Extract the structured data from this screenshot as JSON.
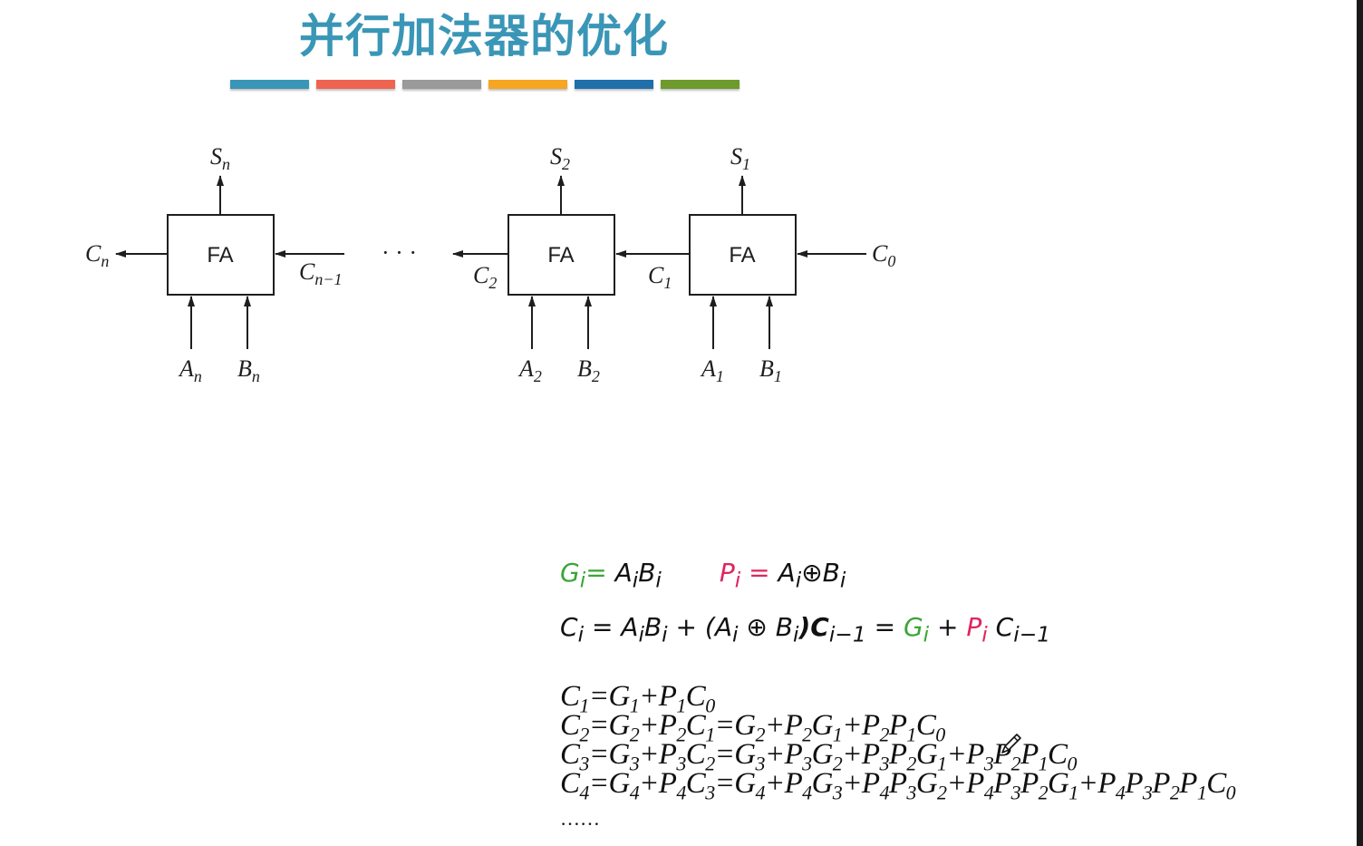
{
  "slide": {
    "title": "并行加法器的优化",
    "accent_colors": [
      "#3a96b6",
      "#ef6351",
      "#9a9a9a",
      "#f6a623",
      "#1f6faa",
      "#6e9a2e"
    ],
    "green": "#3aa535",
    "pink": "#e0245e"
  },
  "diagram": {
    "cell_label": "FA",
    "ellipsis": "· · ·",
    "labels": {
      "Sn": "S",
      "Sn_sub": "n",
      "S2": "S",
      "S2_sub": "2",
      "S1": "S",
      "S1_sub": "1",
      "Cn": "C",
      "Cn_sub": "n",
      "Cn1": "C",
      "Cn1_sub": "n−1",
      "C2": "C",
      "C2_sub": "2",
      "C1": "C",
      "C1_sub": "1",
      "C0": "C",
      "C0_sub": "0",
      "An": "A",
      "An_sub": "n",
      "Bn": "B",
      "Bn_sub": "n",
      "A2": "A",
      "A2_sub": "2",
      "B2": "B",
      "B2_sub": "2",
      "A1": "A",
      "A1_sub": "1",
      "B1": "B",
      "B1_sub": "1"
    }
  },
  "formulas": {
    "g_lhs": "G",
    "g_lhs_sub": "i",
    "g_eq": "= ",
    "g_rhs_a": "A",
    "g_rhs_a_sub": "i",
    "g_rhs_b": "B",
    "g_rhs_b_sub": "i",
    "p_lhs": "P",
    "p_lhs_sub": "i",
    "p_eq": " = ",
    "p_rhs_a": "A",
    "p_rhs_a_sub": "i",
    "p_xor": "⊕",
    "p_rhs_b": "B",
    "p_rhs_b_sub": "i",
    "ci_lhs": "C",
    "ci_lhs_sub": "i",
    "ci_mid1": " = A",
    "ci_mid1_sub": "i",
    "ci_mid2": "B",
    "ci_mid2_sub": "i",
    "ci_mid3": " + (A",
    "ci_mid3_sub": "i",
    "ci_mid4": " ⊕ B",
    "ci_mid4_sub": "i",
    "ci_mid5": ")C",
    "ci_mid5_sub": "i−1",
    "ci_eq": " = ",
    "ci_g": "G",
    "ci_g_sub": "i",
    "ci_plus": " + ",
    "ci_p": "P",
    "ci_p_sub": "i",
    "ci_c": " C",
    "ci_c_sub": "i−1"
  },
  "expansions": [
    [
      [
        "C",
        "1"
      ],
      [
        "=G",
        "1"
      ],
      [
        "+P",
        "1"
      ],
      [
        "C",
        "0"
      ]
    ],
    [
      [
        "C",
        "2"
      ],
      [
        "=G",
        "2"
      ],
      [
        "+P",
        "2"
      ],
      [
        "C",
        "1"
      ],
      [
        "=G",
        "2"
      ],
      [
        "+P",
        "2"
      ],
      [
        "G",
        "1"
      ],
      [
        "+P",
        "2"
      ],
      [
        "P",
        "1"
      ],
      [
        "C",
        "0"
      ]
    ],
    [
      [
        "C",
        "3"
      ],
      [
        "=G",
        "3"
      ],
      [
        "+P",
        "3"
      ],
      [
        "C",
        "2"
      ],
      [
        "=G",
        "3"
      ],
      [
        "+P",
        "3"
      ],
      [
        "G",
        "2"
      ],
      [
        "+P",
        "3"
      ],
      [
        "P",
        "2"
      ],
      [
        "G",
        "1"
      ],
      [
        "+P",
        "3"
      ],
      [
        "P",
        "2"
      ],
      [
        "P",
        "1"
      ],
      [
        "C",
        "0"
      ]
    ],
    [
      [
        "C",
        "4"
      ],
      [
        "=G",
        "4"
      ],
      [
        "+P",
        "4"
      ],
      [
        "C",
        "3"
      ],
      [
        "=G",
        "4"
      ],
      [
        "+P",
        "4"
      ],
      [
        "G",
        "3"
      ],
      [
        "+P",
        "4"
      ],
      [
        "P",
        "3"
      ],
      [
        "G",
        "2"
      ],
      [
        "+P",
        "4"
      ],
      [
        "P",
        "3"
      ],
      [
        "P",
        "2"
      ],
      [
        "G",
        "1"
      ],
      [
        "+P",
        "4"
      ],
      [
        "P",
        "3"
      ],
      [
        "P",
        "2"
      ],
      [
        "P",
        "1"
      ],
      [
        "C",
        "0"
      ]
    ]
  ],
  "ellipsis_text": "……",
  "pencil_icon": "pencil-cursor-icon"
}
